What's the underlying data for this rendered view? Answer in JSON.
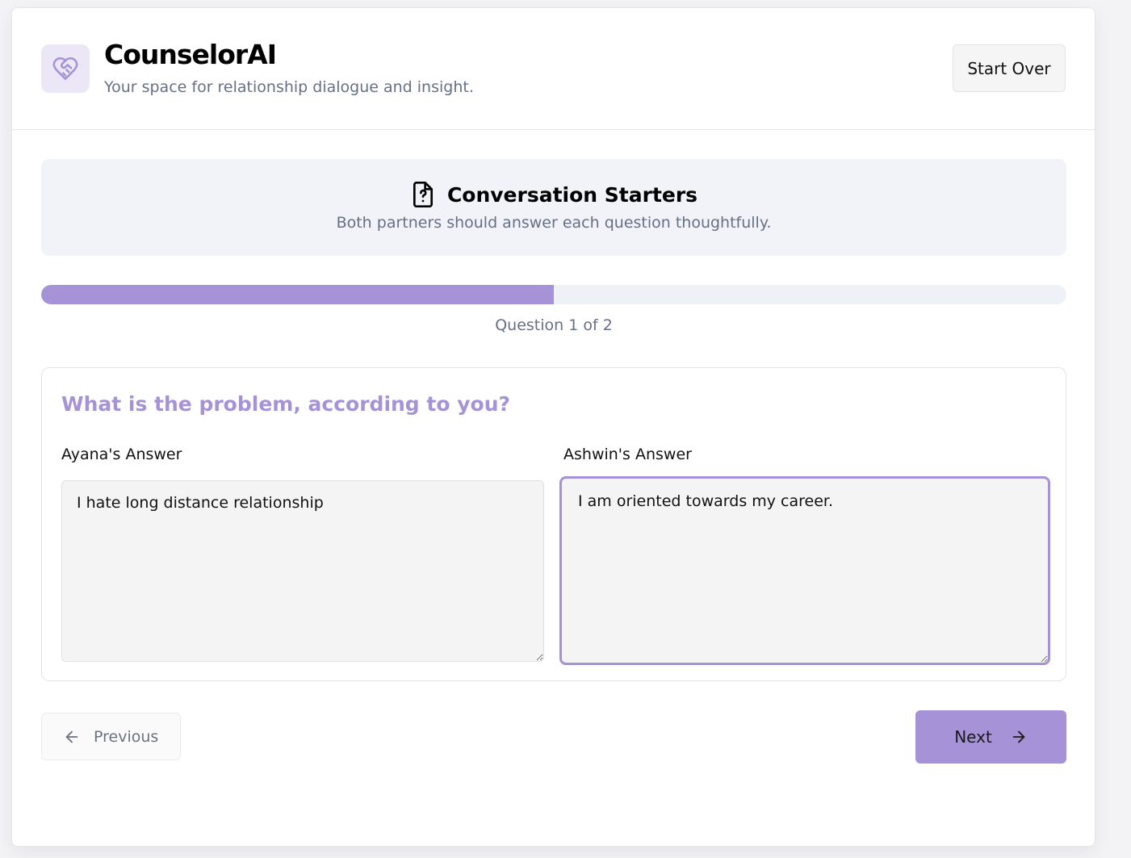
{
  "app": {
    "title": "CounselorAI",
    "subtitle": "Your space for relationship dialogue and insight.",
    "logo_icon": "heart-handshake-icon"
  },
  "header": {
    "start_over_label": "Start Over"
  },
  "starters": {
    "icon": "question-file-icon",
    "title": "Conversation Starters",
    "subtitle": "Both partners should answer each question thoughtfully."
  },
  "progress": {
    "fraction": 0.5,
    "label": "Question 1 of 2"
  },
  "question": {
    "text": "What is the problem, according to you?",
    "answers": [
      {
        "label": "Ayana's Answer",
        "value": "I hate long distance relationship"
      },
      {
        "label": "Ashwin's Answer",
        "value": "I am oriented towards my career."
      }
    ]
  },
  "nav": {
    "previous_label": "Previous",
    "previous_icon": "arrow-left-icon",
    "next_label": "Next",
    "next_icon": "arrow-right-icon"
  },
  "colors": {
    "accent": "#a692d6",
    "accent_light": "#ece7f7",
    "muted_text": "#667085",
    "panel_bg": "#f1f3f8"
  }
}
